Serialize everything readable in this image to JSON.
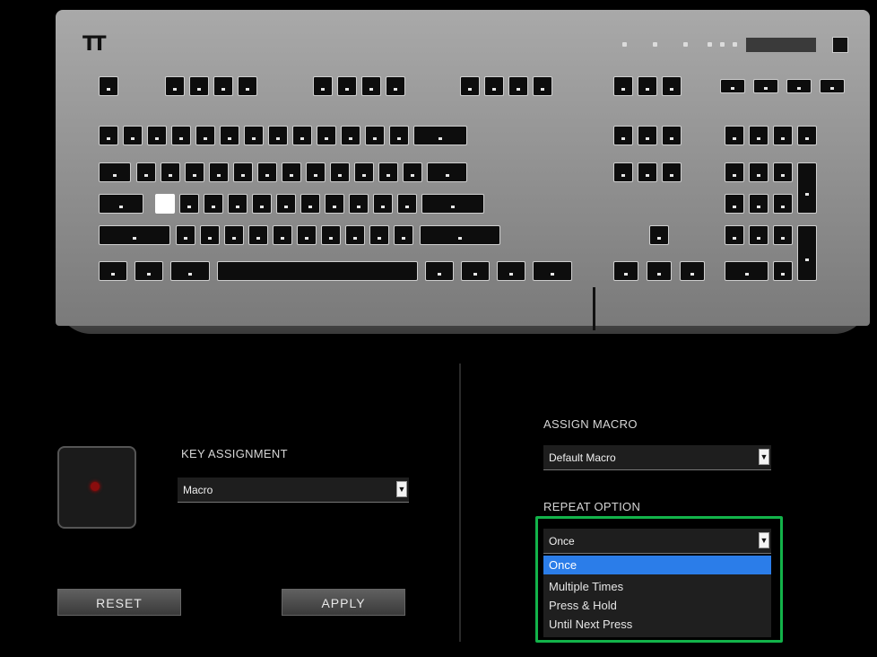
{
  "brand": "TT",
  "key_assignment": {
    "label": "KEY ASSIGNMENT",
    "value": "Macro"
  },
  "assign_macro": {
    "label": "ASSIGN MACRO",
    "value": "Default Macro"
  },
  "repeat_option": {
    "label": "REPEAT OPTION",
    "value": "Once",
    "options": [
      "Once",
      "Multiple Times",
      "Press & Hold",
      "Until Next Press"
    ],
    "selected_index": 0
  },
  "buttons": {
    "reset": "RESET",
    "apply": "APPLY"
  },
  "colors": {
    "highlight": "#12b34a",
    "selected_option": "#2b7de9",
    "key_led": "#8a0d0d"
  }
}
